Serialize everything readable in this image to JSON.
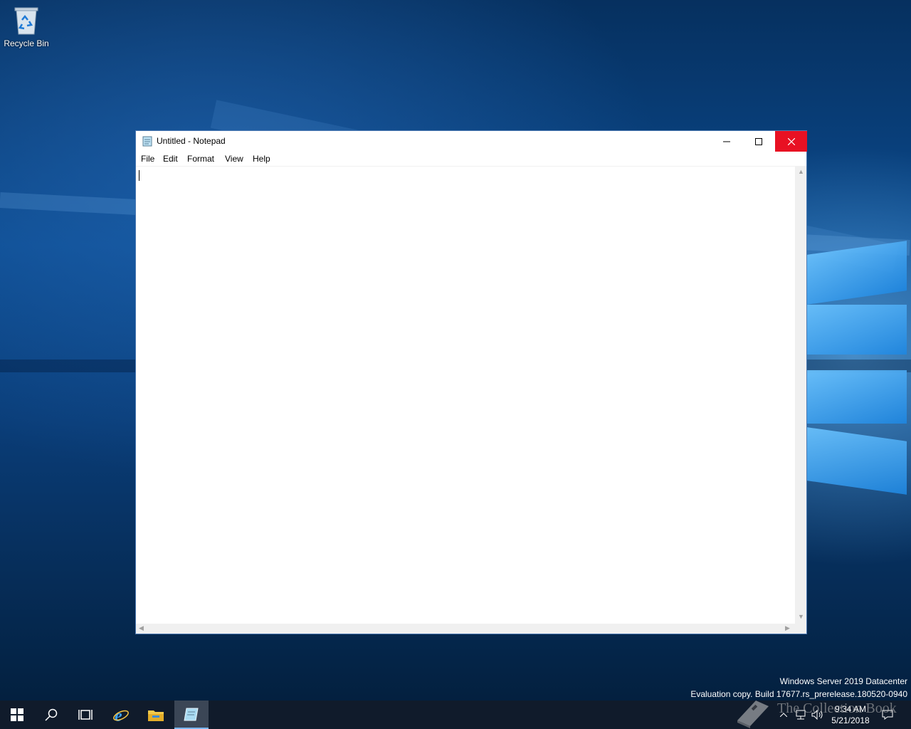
{
  "desktop": {
    "icons": [
      {
        "label": "Recycle Bin",
        "icon": "recycle-bin-icon"
      }
    ],
    "watermark": {
      "line1": "Windows Server 2019 Datacenter",
      "line2": "Evaluation copy. Build 17677.rs_prerelease.180520-0940"
    }
  },
  "notepad": {
    "title": "Untitled - Notepad",
    "menu": [
      "File",
      "Edit",
      "Format",
      "View",
      "Help"
    ],
    "content": ""
  },
  "taskbar": {
    "items": [
      "start-icon",
      "search-icon",
      "task-view-icon",
      "internet-explorer-icon",
      "file-explorer-icon",
      "notepad-icon"
    ],
    "active_item": "notepad-icon",
    "clock": {
      "time": "9:34 AM",
      "date": "5/21/2018"
    },
    "overlay_stamp": "The Collection Book"
  },
  "colors": {
    "close_button": "#e81123",
    "taskbar": "#101b2b",
    "accent": "#4d7ab3"
  }
}
